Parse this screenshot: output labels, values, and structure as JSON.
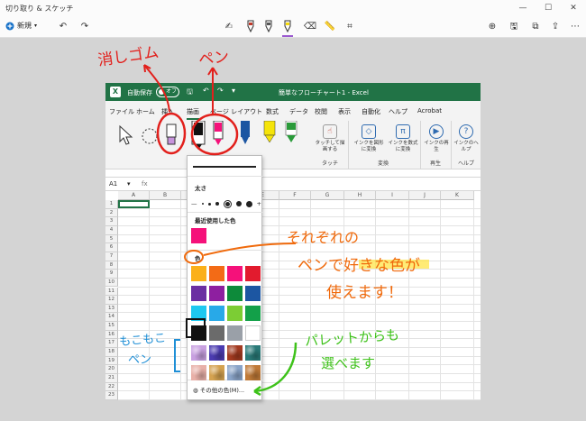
{
  "window": {
    "title": "切り取り & スケッチ",
    "min": "—",
    "max": "☐",
    "close": "✕"
  },
  "toolbar": {
    "new_label": "新規",
    "new_icon": "plus-icon"
  },
  "excel": {
    "autosave_label": "自動保存",
    "toggle_label": "オフ",
    "doc_title": "簡単なフローチャート1 - Excel",
    "menu": [
      "ファイル",
      "ホーム",
      "挿入",
      "描画",
      "ページ レイアウト",
      "数式",
      "データ",
      "校閲",
      "表示",
      "自動化",
      "ヘルプ",
      "Acrobat"
    ],
    "ribbon": {
      "touch_btn": "タッチして描画する",
      "touch_group": "タッチ",
      "convert_shape": "インクを図形に変換",
      "convert_math": "インクを数式に変換",
      "convert_group": "変換",
      "replay_btn": "インクの再生",
      "replay_group": "再生",
      "help_btn": "インクのヘルプ",
      "help_group": "ヘルプ"
    },
    "namebox": "A1",
    "fx": "fx",
    "columns": [
      "A",
      "B",
      "C",
      "D",
      "E",
      "F",
      "G",
      "H",
      "I",
      "J",
      "K"
    ],
    "rows": [
      "1",
      "2",
      "3",
      "4",
      "5",
      "6",
      "7",
      "8",
      "9",
      "10",
      "11",
      "12",
      "13",
      "14",
      "15",
      "16",
      "17",
      "18",
      "19",
      "20",
      "21",
      "22",
      "23"
    ]
  },
  "panel": {
    "size_label": "太さ",
    "recent_label": "最近使用した色",
    "color_label": "色",
    "more_colors": "その他の色(M)...",
    "minus": "—",
    "plus": "+",
    "recent_color": "#f5117a",
    "colors": [
      [
        "#fbb01a",
        "#f36b16",
        "#f5117a",
        "#e21b2e"
      ],
      [
        "#6b2fa2",
        "#8e1fa0",
        "#0d8a3a",
        "#1c56a2"
      ],
      [
        "#1ec8f0",
        "#28a9e8",
        "#7ccd34",
        "#13a049"
      ],
      [
        "#111111",
        "#6b6b6b",
        "#9aa0a8",
        "#ffffff"
      ]
    ],
    "textures": [
      "#c8a0e0",
      "#4b3bb0",
      "#a33a20",
      "#2a7a78",
      "#e8b0a8",
      "#d4a250",
      "#8aa4c8",
      "#c07a38"
    ]
  },
  "annotations": {
    "eraser": "消しゴム",
    "pen": "ペン",
    "each_line1": "それぞれの",
    "each_line2": "ペンで好きな色が",
    "each_line3": "使えます！",
    "moko_line1": "もこもこ",
    "moko_line2": "ペン",
    "palette_line1": "パレットからも",
    "palette_line2": "選べます"
  }
}
